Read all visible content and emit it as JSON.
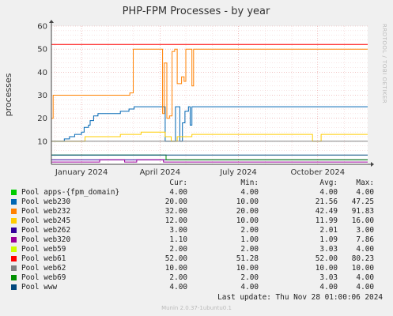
{
  "chart_data": {
    "type": "line",
    "title": "PHP-FPM Processes - by year",
    "ylabel": "processes",
    "ylim": [
      0,
      60
    ],
    "yticks": [
      10,
      20,
      30,
      40,
      50,
      60
    ],
    "ytick_labels": [
      "10",
      "20",
      "30",
      "40",
      "50",
      "60"
    ],
    "xlim": [
      "2023-11-27",
      "2024-11-28"
    ],
    "xticks": [
      "2024-01-01",
      "2024-04-01",
      "2024-07-01",
      "2024-10-01"
    ],
    "xtick_labels": [
      "January 2024",
      "April 2024",
      "July 2024",
      "October 2024"
    ],
    "grid": true,
    "series": [
      {
        "name": "Pool apps-{fpm_domain}",
        "color": "#00cc00",
        "cur": "4.00",
        "min": "4.00",
        "avg": "4.00",
        "max": "4.00",
        "points": []
      },
      {
        "name": "Pool web230",
        "color": "#0066b3",
        "cur": "20.00",
        "min": "10.00",
        "avg": "21.56",
        "max": "47.25",
        "points": [
          [
            "2023-11-28",
            10
          ],
          [
            "2023-12-10",
            10
          ],
          [
            "2023-12-12",
            11
          ],
          [
            "2023-12-18",
            12
          ],
          [
            "2023-12-24",
            13
          ],
          [
            "2024-01-01",
            14
          ],
          [
            "2024-01-04",
            16
          ],
          [
            "2024-01-09",
            17
          ],
          [
            "2024-01-11",
            19
          ],
          [
            "2024-01-15",
            21
          ],
          [
            "2024-01-20",
            22
          ],
          [
            "2024-02-10",
            22
          ],
          [
            "2024-02-15",
            23
          ],
          [
            "2024-02-25",
            24
          ],
          [
            "2024-03-02",
            25
          ],
          [
            "2024-04-05",
            25
          ],
          [
            "2024-04-07",
            10
          ],
          [
            "2024-04-17",
            10
          ],
          [
            "2024-04-19",
            25
          ],
          [
            "2024-04-22",
            25
          ],
          [
            "2024-04-24",
            10
          ],
          [
            "2024-04-27",
            18
          ],
          [
            "2024-04-30",
            23
          ],
          [
            "2024-05-04",
            25
          ],
          [
            "2024-05-06",
            17
          ],
          [
            "2024-05-08",
            25
          ],
          [
            "2024-11-28",
            25
          ]
        ]
      },
      {
        "name": "Pool web232",
        "color": "#ff8000",
        "cur": "32.00",
        "min": "20.00",
        "avg": "42.49",
        "max": "91.83",
        "points": [
          [
            "2023-11-27",
            20
          ],
          [
            "2023-11-29",
            30
          ],
          [
            "2024-02-26",
            31
          ],
          [
            "2024-03-01",
            50
          ],
          [
            "2024-04-02",
            50
          ],
          [
            "2024-04-04",
            22
          ],
          [
            "2024-04-06",
            44
          ],
          [
            "2024-04-09",
            20
          ],
          [
            "2024-04-12",
            21
          ],
          [
            "2024-04-15",
            49
          ],
          [
            "2024-04-18",
            50
          ],
          [
            "2024-04-21",
            35
          ],
          [
            "2024-04-26",
            38
          ],
          [
            "2024-04-29",
            36
          ],
          [
            "2024-05-01",
            50
          ],
          [
            "2024-05-06",
            50
          ],
          [
            "2024-05-08",
            34
          ],
          [
            "2024-05-10",
            50
          ],
          [
            "2024-11-28",
            50
          ]
        ]
      },
      {
        "name": "Pool web245",
        "color": "#ffcc00",
        "cur": "12.00",
        "min": "10.00",
        "avg": "11.99",
        "max": "16.00",
        "points": [
          [
            "2023-11-27",
            10
          ],
          [
            "2024-01-05",
            12
          ],
          [
            "2024-02-15",
            13
          ],
          [
            "2024-03-10",
            14
          ],
          [
            "2024-04-07",
            12
          ],
          [
            "2024-04-14",
            10
          ],
          [
            "2024-04-21",
            12
          ],
          [
            "2024-05-08",
            13
          ],
          [
            "2024-09-25",
            10
          ],
          [
            "2024-10-05",
            13
          ],
          [
            "2024-11-28",
            13
          ]
        ]
      },
      {
        "name": "Pool web262",
        "color": "#330099",
        "cur": "3.00",
        "min": "2.00",
        "avg": "2.01",
        "max": "3.00",
        "points": [
          [
            "2023-11-27",
            2
          ],
          [
            "2024-11-28",
            2
          ]
        ]
      },
      {
        "name": "Pool web320",
        "color": "#990099",
        "cur": "1.10",
        "min": "1.00",
        "avg": "1.09",
        "max": "7.86",
        "points": [
          [
            "2023-11-27",
            1
          ],
          [
            "2024-01-20",
            1
          ],
          [
            "2024-01-22",
            2
          ],
          [
            "2024-02-20",
            1
          ],
          [
            "2024-03-05",
            2
          ],
          [
            "2024-04-05",
            1
          ],
          [
            "2024-11-28",
            1
          ]
        ]
      },
      {
        "name": "Pool web59",
        "color": "#ccff00",
        "cur": "2.00",
        "min": "2.00",
        "avg": "3.03",
        "max": "4.00",
        "points": []
      },
      {
        "name": "Pool web61",
        "color": "#ff0000",
        "cur": "52.00",
        "min": "51.28",
        "avg": "52.00",
        "max": "80.23",
        "points": [
          [
            "2023-11-27",
            52
          ],
          [
            "2024-11-28",
            52
          ]
        ]
      },
      {
        "name": "Pool web62",
        "color": "#808080",
        "cur": "10.00",
        "min": "10.00",
        "avg": "10.00",
        "max": "10.00",
        "points": [
          [
            "2023-11-27",
            10
          ],
          [
            "2024-11-28",
            10
          ]
        ]
      },
      {
        "name": "Pool web69",
        "color": "#008f00",
        "cur": "2.00",
        "min": "2.00",
        "avg": "3.03",
        "max": "4.00",
        "points": [
          [
            "2023-11-27",
            4
          ],
          [
            "2024-04-05",
            4
          ],
          [
            "2024-04-08",
            2
          ],
          [
            "2024-11-28",
            2
          ]
        ]
      },
      {
        "name": "Pool www",
        "color": "#00487d",
        "cur": "4.00",
        "min": "4.00",
        "avg": "4.00",
        "max": "4.00",
        "points": [
          [
            "2023-11-27",
            4
          ],
          [
            "2024-11-28",
            4
          ]
        ]
      }
    ]
  },
  "legend_headers": {
    "cur": "Cur:",
    "min": "Min:",
    "avg": "Avg:",
    "max": "Max:"
  },
  "last_update": "Last update: Thu Nov 28 01:00:06 2024",
  "watermark": "RRDTOOL / TOBI OETIKER",
  "footer": "Munin 2.0.37-1ubuntu0.1"
}
